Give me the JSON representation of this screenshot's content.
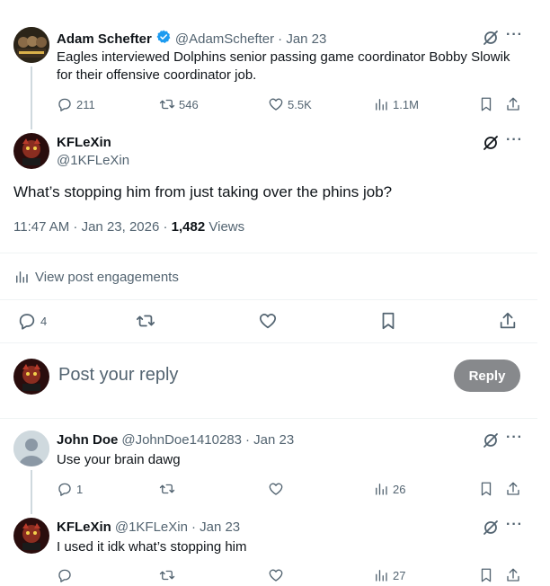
{
  "quoted_post": {
    "author_name": "Adam Schefter",
    "author_handle": "@AdamSchefter",
    "date": "· Jan 23",
    "text_line1": "Eagles interviewed Dolphins senior passing game coordinator Bobby Slowik",
    "text_line2": "for their offensive coordinator job.",
    "replies": "211",
    "reposts": "546",
    "likes": "5.5K",
    "views": "1.1M"
  },
  "main_post": {
    "author_name": "KFLeXin",
    "author_handle": "@1KFLeXin",
    "text": "What’s stopping him from just taking over the phins job?",
    "timestamp": "11:47 AM · Jan 23, 2026 ·",
    "views_count": "1,482",
    "views_label": "Views",
    "engagements_link": "View post engagements",
    "replies": "4"
  },
  "composer": {
    "placeholder": "Post your reply",
    "button_label": "Reply"
  },
  "reply1": {
    "author_name": "John Doe",
    "author_handle": "@JohnDoe1410283",
    "date": "· Jan 23",
    "text": "Use your brain dawg",
    "replies": "1",
    "views": "26"
  },
  "reply2": {
    "author_name": "KFLeXin",
    "author_handle": "@1KFLeXin",
    "date": "· Jan 23",
    "text": "I used it idk what’s stopping him",
    "views": "27"
  },
  "colors": {
    "verified": "#1d9bf0",
    "reply_button": "#87898c",
    "thread_line": "#cfd9de"
  },
  "icons": [
    "verified-badge-icon",
    "grok-icon",
    "more-icon",
    "reply-icon",
    "repost-icon",
    "like-icon",
    "views-icon",
    "bookmark-icon",
    "share-icon",
    "analytics-icon"
  ]
}
